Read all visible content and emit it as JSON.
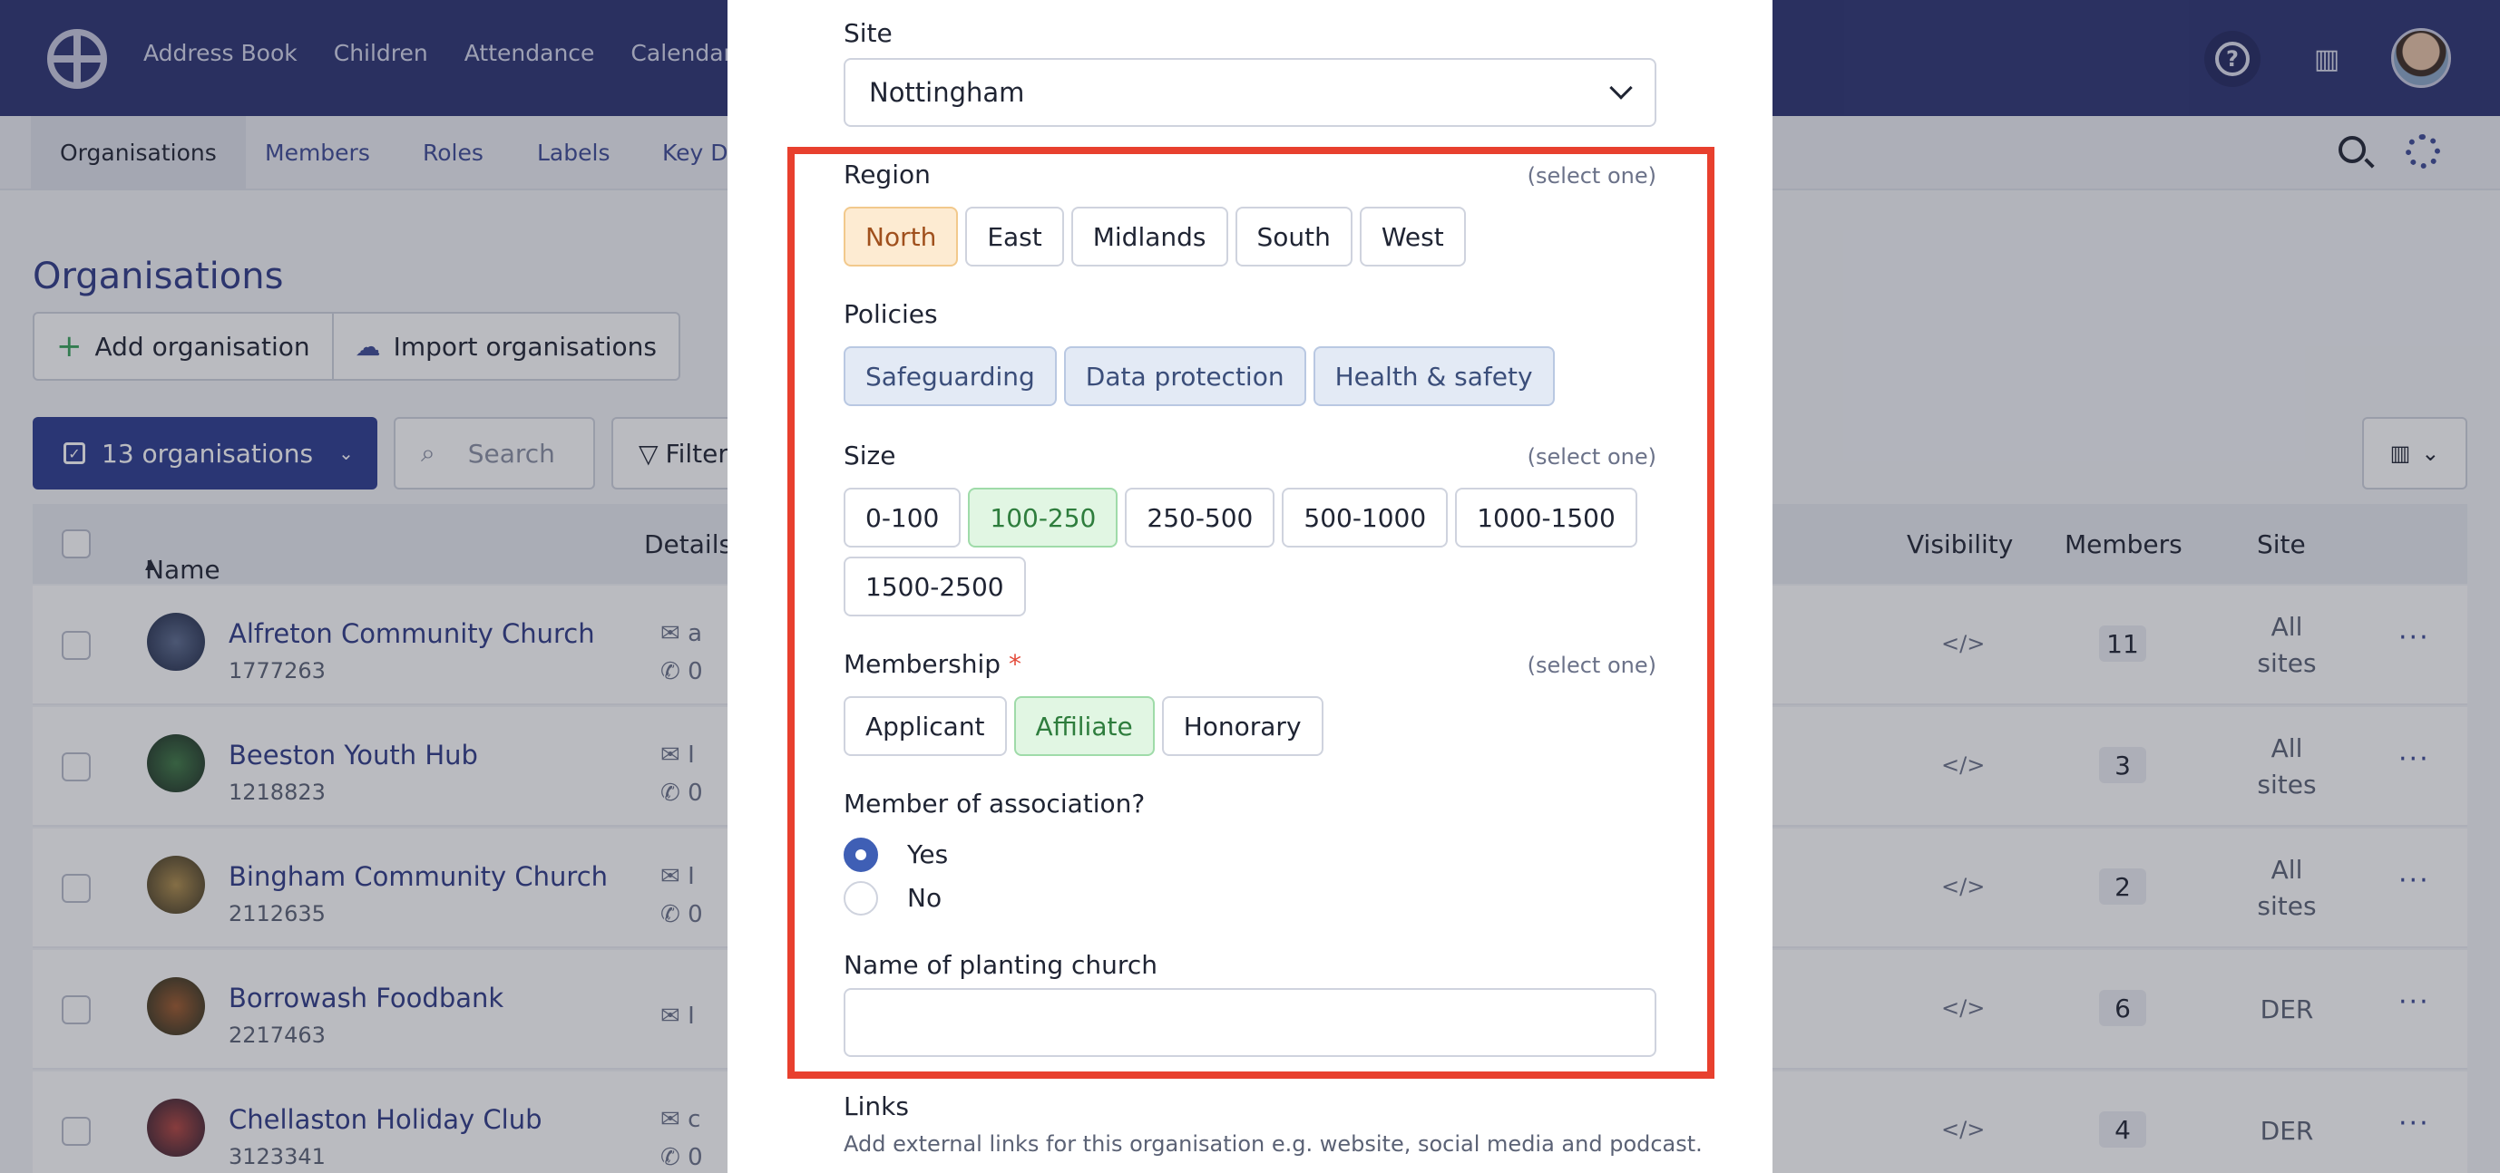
{
  "topnav": [
    "Address Book",
    "Children",
    "Attendance",
    "Calendar"
  ],
  "subnav": [
    "Organisations",
    "Members",
    "Roles",
    "Labels",
    "Key Da"
  ],
  "page_title": "Organisations",
  "toolbar": {
    "add": "Add organisation",
    "import": "Import organisations",
    "count": "13 organisations",
    "search_placeholder": "Search",
    "filter": "Filter"
  },
  "table": {
    "headers": {
      "name": "Name",
      "details": "Details",
      "visibility": "Visibility",
      "members": "Members",
      "site": "Site"
    },
    "rows": [
      {
        "name": "Alfreton Community Church",
        "id": "1777263",
        "email": "a",
        "phone": "0",
        "members": "11",
        "site": "All sites"
      },
      {
        "name": "Beeston Youth Hub",
        "id": "1218823",
        "email": "I",
        "phone": "0",
        "members": "3",
        "site": "All sites"
      },
      {
        "name": "Bingham Community Church",
        "id": "2112635",
        "email": "I",
        "phone": "0",
        "members": "2",
        "site": "All sites"
      },
      {
        "name": "Borrowash Foodbank",
        "id": "2217463",
        "email": "I",
        "phone": "",
        "members": "6",
        "site": "DER"
      },
      {
        "name": "Chellaston Holiday Club",
        "id": "3123341",
        "email": "c",
        "phone": "0",
        "members": "4",
        "site": "DER"
      }
    ]
  },
  "modal": {
    "site_label": "Site",
    "site_value": "Nottingham",
    "region_label": "Region",
    "select_one": "(select one)",
    "region_options": [
      "North",
      "East",
      "Midlands",
      "South",
      "West"
    ],
    "policies_label": "Policies",
    "policies": [
      "Safeguarding",
      "Data protection",
      "Health & safety"
    ],
    "size_label": "Size",
    "size_options": [
      "0-100",
      "100-250",
      "250-500",
      "500-1000",
      "1000-1500",
      "1500-2500"
    ],
    "membership_label": "Membership",
    "membership_required": "*",
    "membership_options": [
      "Applicant",
      "Affiliate",
      "Honorary"
    ],
    "association_label": "Member of association?",
    "yes": "Yes",
    "no": "No",
    "planting_label": "Name of planting church",
    "links_label": "Links",
    "links_help": "Add external links for this organisation e.g. website, social media and podcast."
  },
  "colors": {
    "header_bg": "#2c3372",
    "highlight": "#e8402e",
    "selected_orange": "#fdebd2",
    "selected_green": "#e1f6e3",
    "policy_blue": "#e3eaf5"
  }
}
